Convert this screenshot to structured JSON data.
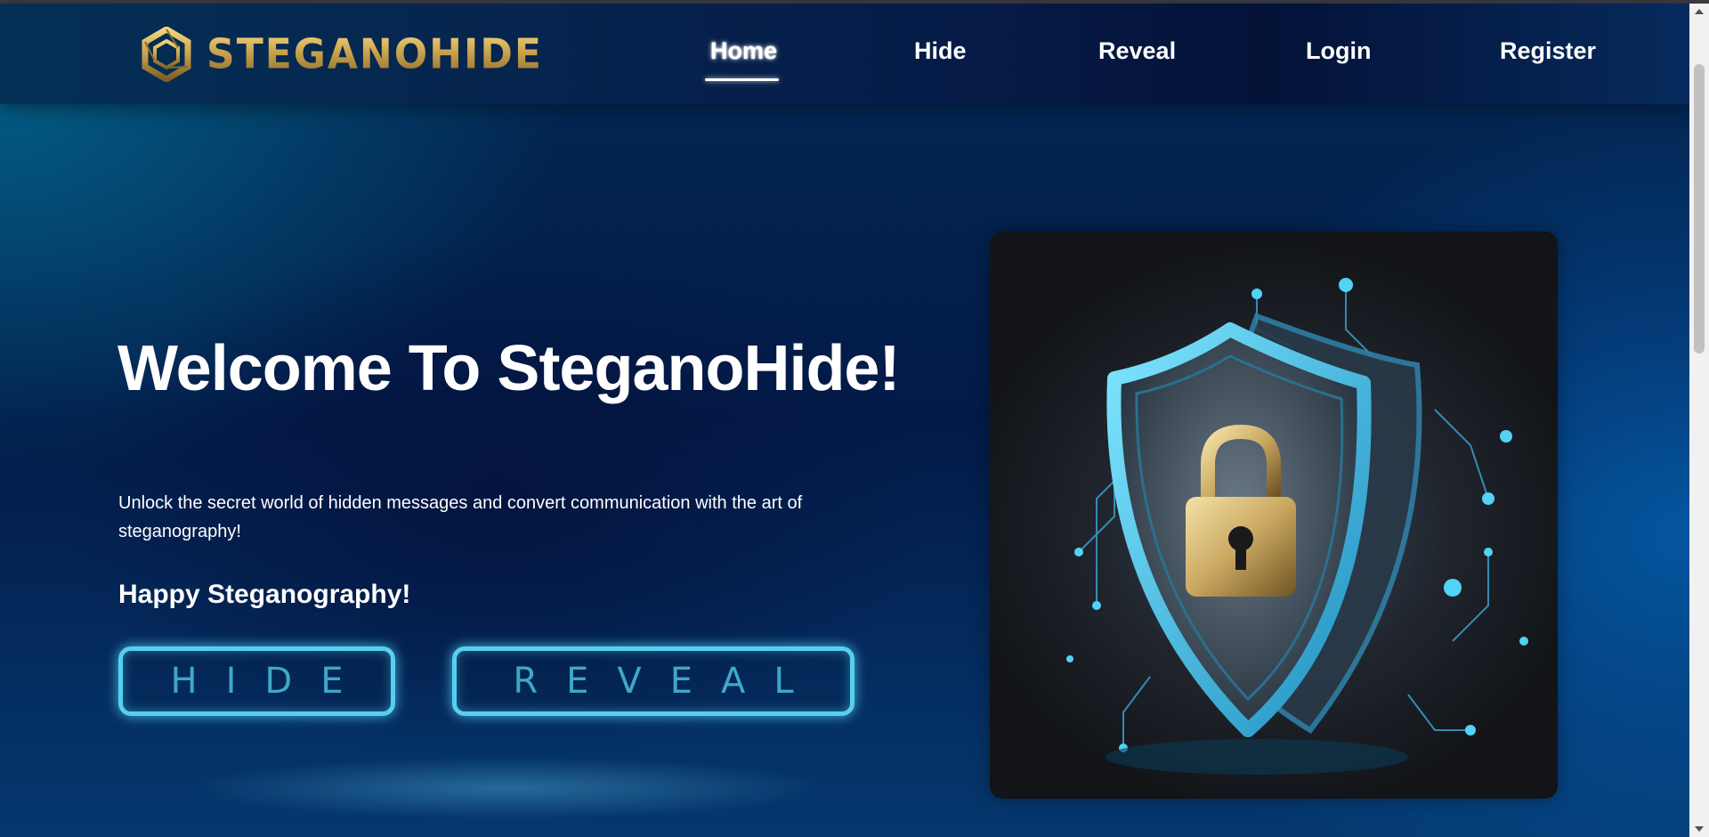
{
  "brand": {
    "logo_text": "STEGANOHIDE",
    "accent": "#c9a24c"
  },
  "nav": {
    "items": [
      {
        "label": "Home",
        "active": true
      },
      {
        "label": "Hide",
        "active": false
      },
      {
        "label": "Reveal",
        "active": false
      },
      {
        "label": "Login",
        "active": false
      },
      {
        "label": "Register",
        "active": false
      }
    ]
  },
  "hero": {
    "title": "Welcome To SteganoHide!",
    "description": "Unlock the secret world of hidden messages and convert communication with the art of steganography!",
    "subtitle": "Happy Steganography!",
    "buttons": {
      "hide": "HIDE",
      "reveal": "REVEAL"
    },
    "image_icon": "shield-padlock-illustration",
    "neon_color": "#56d0f0"
  }
}
